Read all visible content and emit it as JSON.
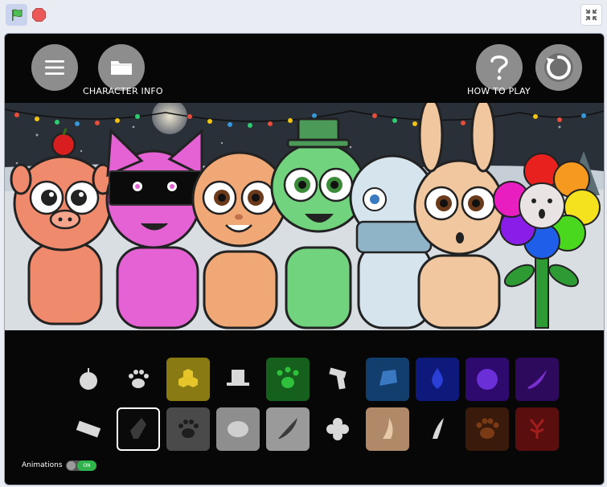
{
  "toolbar": {
    "green_flag_icon": "green-flag-icon",
    "stop_icon": "stop-sign-icon",
    "fullscreen_icon": "exit-fullscreen-icon"
  },
  "stage": {
    "menu_icon": "hamburger-menu-icon",
    "character_info_label": "CHARACTER INFO",
    "how_to_play_label": "HOW TO PLAY",
    "restart_icon": "restart-icon",
    "animations_label": "Animations",
    "animations_toggle_state": "ON"
  },
  "items_row1": [
    {
      "icon": "apple-icon",
      "bg": "",
      "fg": "#d9d9d9"
    },
    {
      "icon": "paw-print-icon",
      "bg": "",
      "fg": "#d9d9d9"
    },
    {
      "icon": "honeycomb-icon",
      "bg": "#8a7a14",
      "fg": "#e6c52a"
    },
    {
      "icon": "top-hat-icon",
      "bg": "",
      "fg": "#d9d9d9"
    },
    {
      "icon": "frog-print-icon",
      "bg": "#15601c",
      "fg": "#2fc13c"
    },
    {
      "icon": "scarf-icon",
      "bg": "",
      "fg": "#d9d9d9"
    },
    {
      "icon": "blue-stone-icon",
      "bg": "#123e6e",
      "fg": "#3a78c2"
    },
    {
      "icon": "water-drop-icon",
      "bg": "#0d1a7c",
      "fg": "#2a3fd6"
    },
    {
      "icon": "purple-swirl-icon",
      "bg": "#2f0a6e",
      "fg": "#6a2fd6"
    },
    {
      "icon": "purple-horn-icon",
      "bg": "#2e0a5c",
      "fg": "#7a2fcf"
    }
  ],
  "items_row2": [
    {
      "icon": "eraser-icon",
      "bg": "",
      "fg": "#d9d9d9"
    },
    {
      "icon": "crystal-icon",
      "bg": "#0a0a0a",
      "fg": "#3a3a3a"
    },
    {
      "icon": "gray-paw-icon",
      "bg": "#4a4a4a",
      "fg": "#1e1e1e"
    },
    {
      "icon": "gray-stone-icon",
      "bg": "#8e8e8e",
      "fg": "#cfcfcf"
    },
    {
      "icon": "feather-icon",
      "bg": "#9a9a9a",
      "fg": "#3a3a3a"
    },
    {
      "icon": "flower-icon",
      "bg": "",
      "fg": "#d9d9d9"
    },
    {
      "icon": "tan-horn-icon",
      "bg": "#b08a68",
      "fg": "#e6c9a6"
    },
    {
      "icon": "white-claw-icon",
      "bg": "",
      "fg": "#d9d9d9"
    },
    {
      "icon": "bear-paw-icon",
      "bg": "#3a1a0a",
      "fg": "#7a3a14"
    },
    {
      "icon": "antler-icon",
      "bg": "#5a0e0e",
      "fg": "#a21e1e"
    }
  ]
}
